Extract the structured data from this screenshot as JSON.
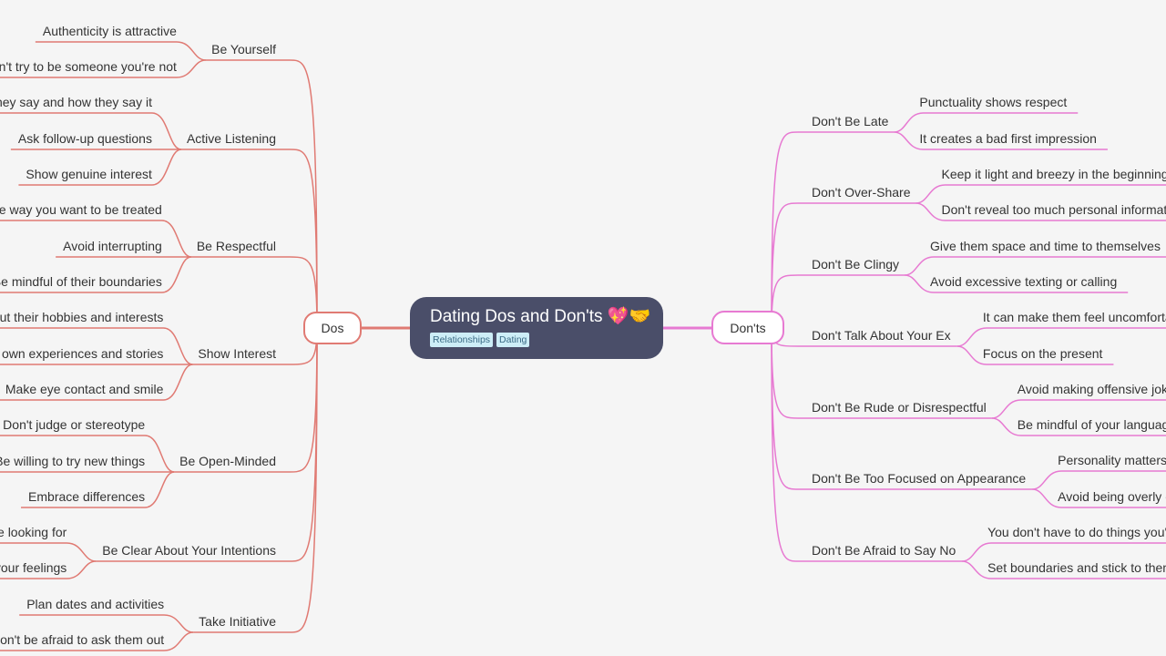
{
  "root": {
    "title": "Dating Dos and Don'ts 💖🤝",
    "tags": [
      "Relationships",
      "Dating"
    ]
  },
  "colors": {
    "dos": "#e07a73",
    "donts": "#e77ad2",
    "root_bg": "#4a4e69",
    "background": "#f5f5f5"
  },
  "dos": {
    "label": "Dos",
    "branches": [
      {
        "label": "Be Yourself",
        "children": [
          "Authenticity is attractive",
          "Don't try to be someone you're not"
        ]
      },
      {
        "label": "Active Listening",
        "children": [
          "Pay attention to what they say and how they say it",
          "Ask follow-up questions",
          "Show genuine interest"
        ]
      },
      {
        "label": "Be Respectful",
        "children": [
          "Treat them the way you want to be treated",
          "Avoid interrupting",
          "Be mindful of their boundaries"
        ]
      },
      {
        "label": "Show Interest",
        "children": [
          "Ask about their hobbies and interests",
          "Share your own experiences and stories",
          "Make eye contact and smile"
        ]
      },
      {
        "label": "Be Open-Minded",
        "children": [
          "Don't judge or stereotype",
          "Be willing to try new things",
          "Embrace differences"
        ]
      },
      {
        "label": "Be Clear About Your Intentions",
        "children": [
          "Be honest about what you're looking for",
          "Communicate your feelings"
        ]
      },
      {
        "label": "Take Initiative",
        "children": [
          "Plan dates and activities",
          "Don't be afraid to ask them out"
        ]
      }
    ]
  },
  "donts": {
    "label": "Don'ts",
    "branches": [
      {
        "label": "Don't Be Late",
        "children": [
          "Punctuality shows respect",
          "It creates a bad first impression"
        ]
      },
      {
        "label": "Don't Over-Share",
        "children": [
          "Keep it light and breezy in the beginning",
          "Don't reveal too much personal information"
        ]
      },
      {
        "label": "Don't Be Clingy",
        "children": [
          "Give them space and time to themselves",
          "Avoid excessive texting or calling"
        ]
      },
      {
        "label": "Don't Talk About Your Ex",
        "children": [
          "It can make them feel uncomfortable",
          "Focus on the present"
        ]
      },
      {
        "label": "Don't Be Rude or Disrespectful",
        "children": [
          "Avoid making offensive jokes",
          "Be mindful of your language"
        ]
      },
      {
        "label": "Don't Be Too Focused on Appearance",
        "children": [
          "Personality matters",
          "Avoid being overly critical"
        ]
      },
      {
        "label": "Don't Be Afraid to Say No",
        "children": [
          "You don't have to do things you're uncomfortable with",
          "Set boundaries and stick to them"
        ]
      }
    ]
  }
}
